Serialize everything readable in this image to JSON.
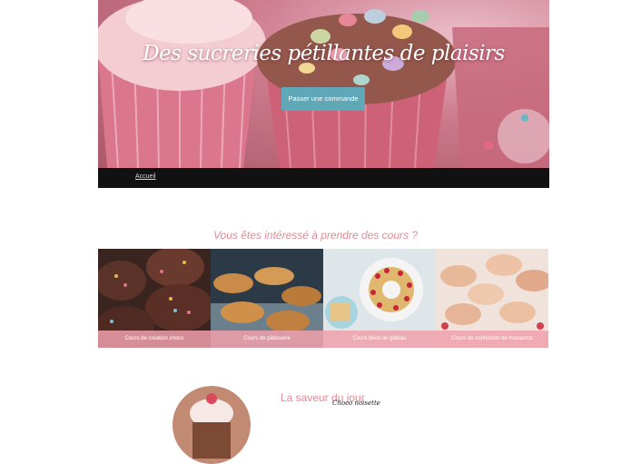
{
  "hero": {
    "title": "Des sucreries pétillantes de plaisirs",
    "cta_label": "Passer une commande"
  },
  "nav": {
    "items": [
      {
        "label": "Accueil"
      }
    ]
  },
  "courses": {
    "heading": "Vous êtes intéressé à prendre des cours ?",
    "items": [
      {
        "label": "Cours de création choco"
      },
      {
        "label": "Cours de pâtisserie"
      },
      {
        "label": "Cours déco de gâteau"
      },
      {
        "label": "Cours de confection de macarons"
      }
    ]
  },
  "flavor": {
    "title": "La saveur du jour",
    "subtitle": "Choco noisette"
  },
  "colors": {
    "accent_pink": "#e38a96",
    "button_teal": "#5fa8b7",
    "nav_bg": "#111111",
    "label_pink": "#f0a0ac"
  }
}
